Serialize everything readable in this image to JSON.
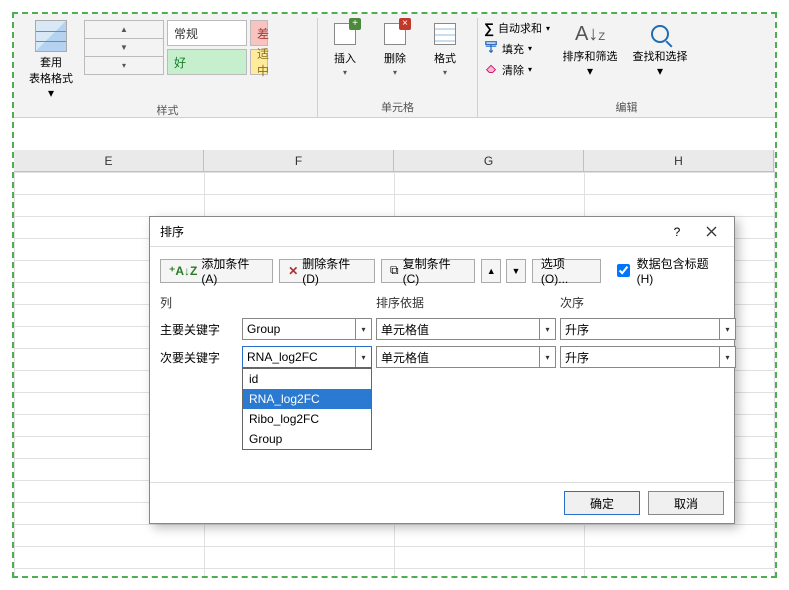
{
  "ribbon": {
    "styles": {
      "group_label": "样式",
      "tableformat_label": "套用\n表格格式",
      "gallery": {
        "changgui": "常规",
        "cha": "差",
        "hao": "好",
        "shizhong": "适中"
      }
    },
    "cells": {
      "group_label": "单元格",
      "insert": "插入",
      "delete": "删除",
      "format": "格式"
    },
    "edit": {
      "group_label": "编辑",
      "autosum": "自动求和",
      "fill": "填充",
      "clear": "清除",
      "sortfilter": "排序和筛选",
      "findselect": "查找和选择"
    }
  },
  "columns": [
    "E",
    "F",
    "G",
    "H"
  ],
  "dialog": {
    "title": "排序",
    "help_glyph": "?",
    "toolbar": {
      "add": "添加条件(A)",
      "delete": "删除条件(D)",
      "copy": "复制条件(C)",
      "options": "选项(O)...",
      "headers_label": "数据包含标题(H)",
      "headers_checked": true
    },
    "headers": {
      "col": "列",
      "basis": "排序依据",
      "order": "次序"
    },
    "rows": [
      {
        "label": "主要关键字",
        "field": "Group",
        "basis": "单元格值",
        "order": "升序"
      },
      {
        "label": "次要关键字",
        "field": "RNA_log2FC",
        "basis": "单元格值",
        "order": "升序"
      }
    ],
    "dropdown_open": {
      "items": [
        "id",
        "RNA_log2FC",
        "Ribo_log2FC",
        "Group"
      ],
      "selected": "RNA_log2FC"
    },
    "buttons": {
      "ok": "确定",
      "cancel": "取消"
    }
  }
}
